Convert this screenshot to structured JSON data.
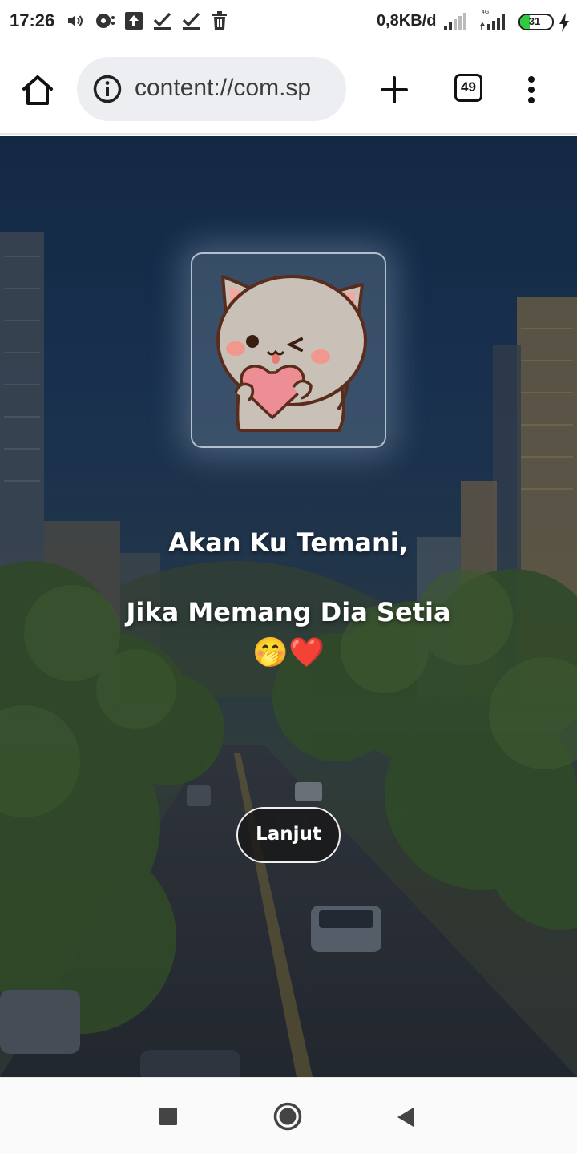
{
  "status_bar": {
    "time": "17:26",
    "net_speed": "0,8KB/d",
    "network_type": "4G",
    "battery_level": "31",
    "battery_percent": 31,
    "icons": [
      "volume-icon",
      "cast-icon",
      "upload-icon",
      "check-icon",
      "check-icon",
      "trash-icon",
      "signal-icon",
      "signal-icon",
      "battery-icon",
      "charging-icon"
    ]
  },
  "browser": {
    "url": "content://com.sp",
    "tab_count": "49",
    "icons": [
      "home-icon",
      "info-icon",
      "plus-icon",
      "tabs-icon",
      "more-vertical-icon"
    ]
  },
  "page": {
    "sticker": "cat-holding-heart-sticker",
    "line1": "Akan Ku Temani,",
    "line2": "Jika Memang Dia Setia",
    "emojis": "🤭❤️",
    "button_label": "Lanjut"
  },
  "nav_bar": {
    "icons": [
      "recents-square-icon",
      "home-circle-icon",
      "back-triangle-icon"
    ]
  },
  "colors": {
    "battery_fill": "#2ecc40",
    "sky": "#16304e",
    "button_bg": "#191919"
  }
}
